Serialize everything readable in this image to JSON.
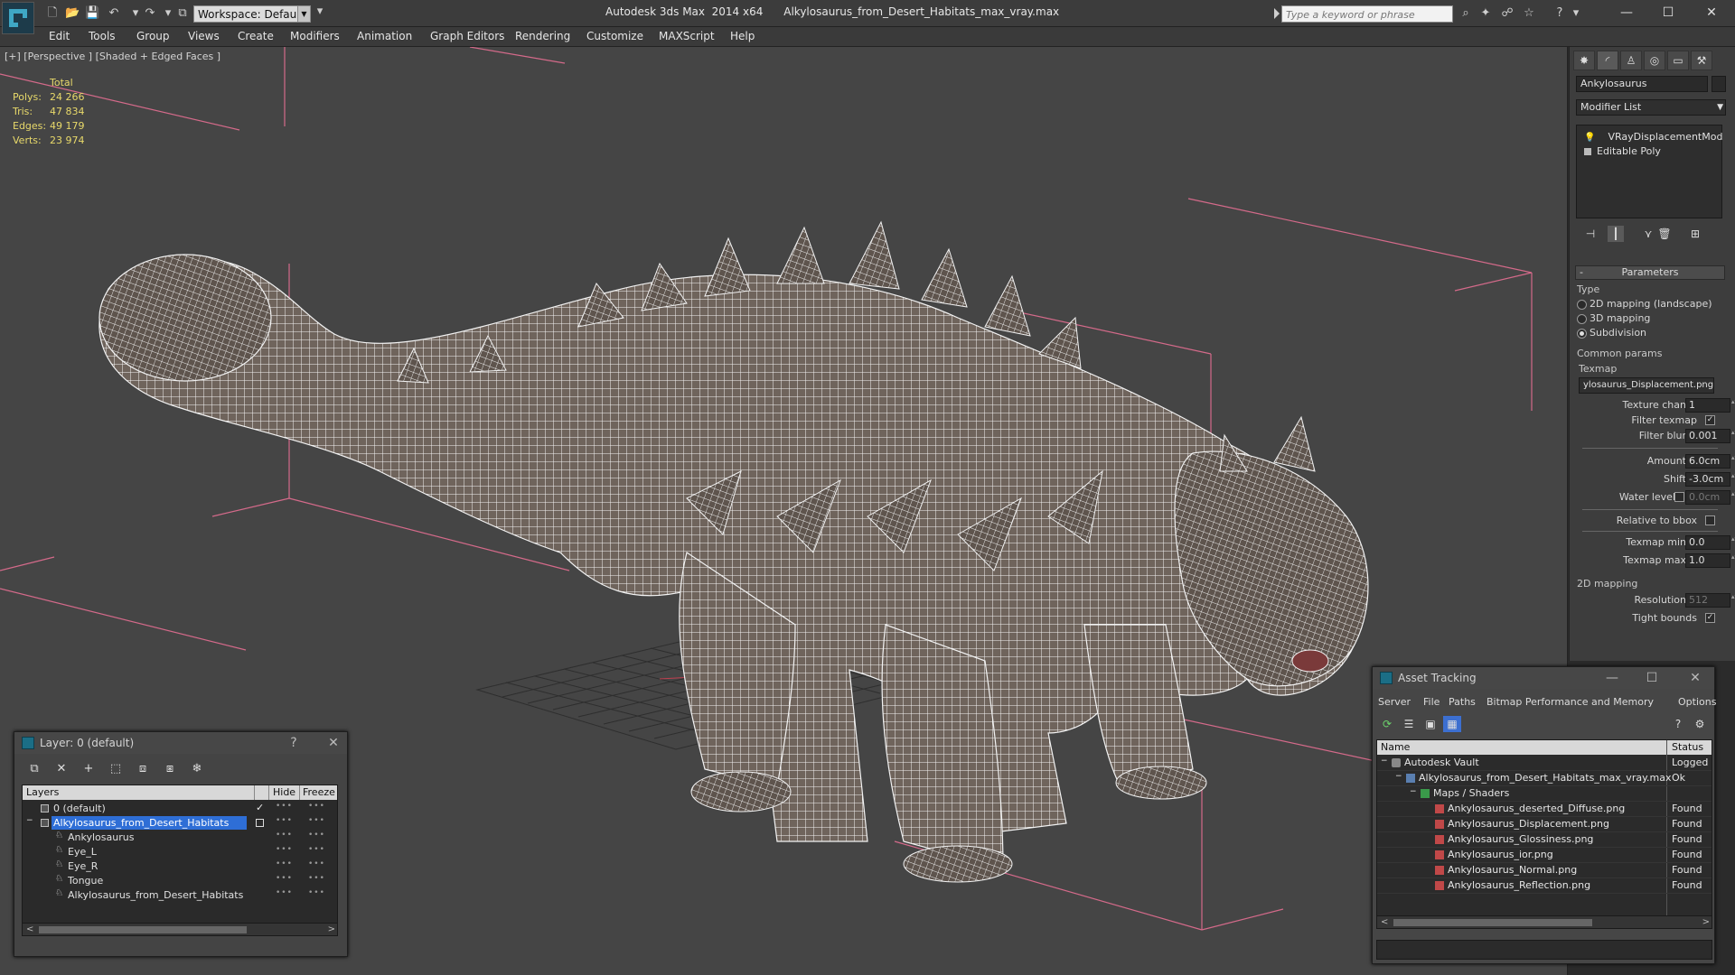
{
  "titlebar": {
    "app_name": "Autodesk 3ds Max  2014 x64",
    "file_name": "Alkylosaurus_from_Desert_Habitats_max_vray.max",
    "workspace": "Workspace: Default",
    "search_placeholder": "Type a keyword or phrase"
  },
  "menu": [
    "Edit",
    "Tools",
    "Group",
    "Views",
    "Create",
    "Modifiers",
    "Animation",
    "Graph Editors",
    "Rendering",
    "Customize",
    "MAXScript",
    "Help"
  ],
  "viewport": {
    "label": "[+] [Perspective ] [Shaded + Edged Faces ]",
    "stats": {
      "header": "Total",
      "polys_label": "Polys:",
      "polys": "24 266",
      "tris_label": "Tris:",
      "tris": "47 834",
      "edges_label": "Edges:",
      "edges": "49 179",
      "verts_label": "Verts:",
      "verts": "23 974"
    }
  },
  "command_panel": {
    "object_name": "Ankylosaurus",
    "modifier_list": "Modifier List",
    "stack": [
      "VRayDisplacementMod",
      "Editable Poly"
    ],
    "parameters_title": "Parameters",
    "type_label": "Type",
    "type_options": [
      "2D mapping (landscape)",
      "3D mapping",
      "Subdivision"
    ],
    "common_label": "Common params",
    "texmap_label": "Texmap",
    "texmap_value": "ylosaurus_Displacement.png)",
    "texture_chan_label": "Texture chan",
    "texture_chan": "1",
    "filter_texmap_label": "Filter texmap",
    "filter_blur_label": "Filter blur",
    "filter_blur": "0.001",
    "amount_label": "Amount",
    "amount": "6.0cm",
    "shift_label": "Shift",
    "shift": "-3.0cm",
    "water_level_label": "Water level",
    "water_level": "0.0cm",
    "relative_bbox_label": "Relative to bbox",
    "texmap_min_label": "Texmap min",
    "texmap_min": "0.0",
    "texmap_max_label": "Texmap max",
    "texmap_max": "1.0",
    "mapping_2d_label": "2D mapping",
    "resolution_label": "Resolution",
    "resolution": "512",
    "tight_bounds_label": "Tight bounds"
  },
  "layer_dialog": {
    "title": "Layer: 0 (default)",
    "help": "?",
    "col_layers": "Layers",
    "col_hide": "Hide",
    "col_freeze": "Freeze",
    "rows": [
      {
        "name": "0 (default)",
        "indent": 0,
        "checked": true
      },
      {
        "name": "Alkylosaurus_from_Desert_Habitats",
        "indent": 0,
        "selected": true
      },
      {
        "name": "Ankylosaurus",
        "indent": 1
      },
      {
        "name": "Eye_L",
        "indent": 1
      },
      {
        "name": "Eye_R",
        "indent": 1
      },
      {
        "name": "Tongue",
        "indent": 1
      },
      {
        "name": "Alkylosaurus_from_Desert_Habitats",
        "indent": 1
      }
    ]
  },
  "asset_dialog": {
    "title": "Asset Tracking",
    "menu": [
      "Server",
      "File",
      "Paths",
      "Bitmap Performance and Memory",
      "Options"
    ],
    "col_name": "Name",
    "col_status": "Status",
    "rows": [
      {
        "name": "Autodesk Vault",
        "status": "Logged O",
        "level": 0
      },
      {
        "name": "Alkylosaurus_from_Desert_Habitats_max_vray.max",
        "status": "Ok",
        "level": 1
      },
      {
        "name": "Maps / Shaders",
        "status": "",
        "level": 2
      },
      {
        "name": "Ankylosaurus_deserted_Diffuse.png",
        "status": "Found",
        "level": 3
      },
      {
        "name": "Ankylosaurus_Displacement.png",
        "status": "Found",
        "level": 3
      },
      {
        "name": "Ankylosaurus_Glossiness.png",
        "status": "Found",
        "level": 3
      },
      {
        "name": "Ankylosaurus_ior.png",
        "status": "Found",
        "level": 3
      },
      {
        "name": "Ankylosaurus_Normal.png",
        "status": "Found",
        "level": 3
      },
      {
        "name": "Ankylosaurus_Reflection.png",
        "status": "Found",
        "level": 3
      }
    ]
  },
  "colors": {
    "accent": "#2e6ed6",
    "stats_text": "#e8d96a",
    "bbox_lines": "#d46a8a",
    "mesh_wire": "#ffffff",
    "mesh_fill": "#6f645c"
  }
}
